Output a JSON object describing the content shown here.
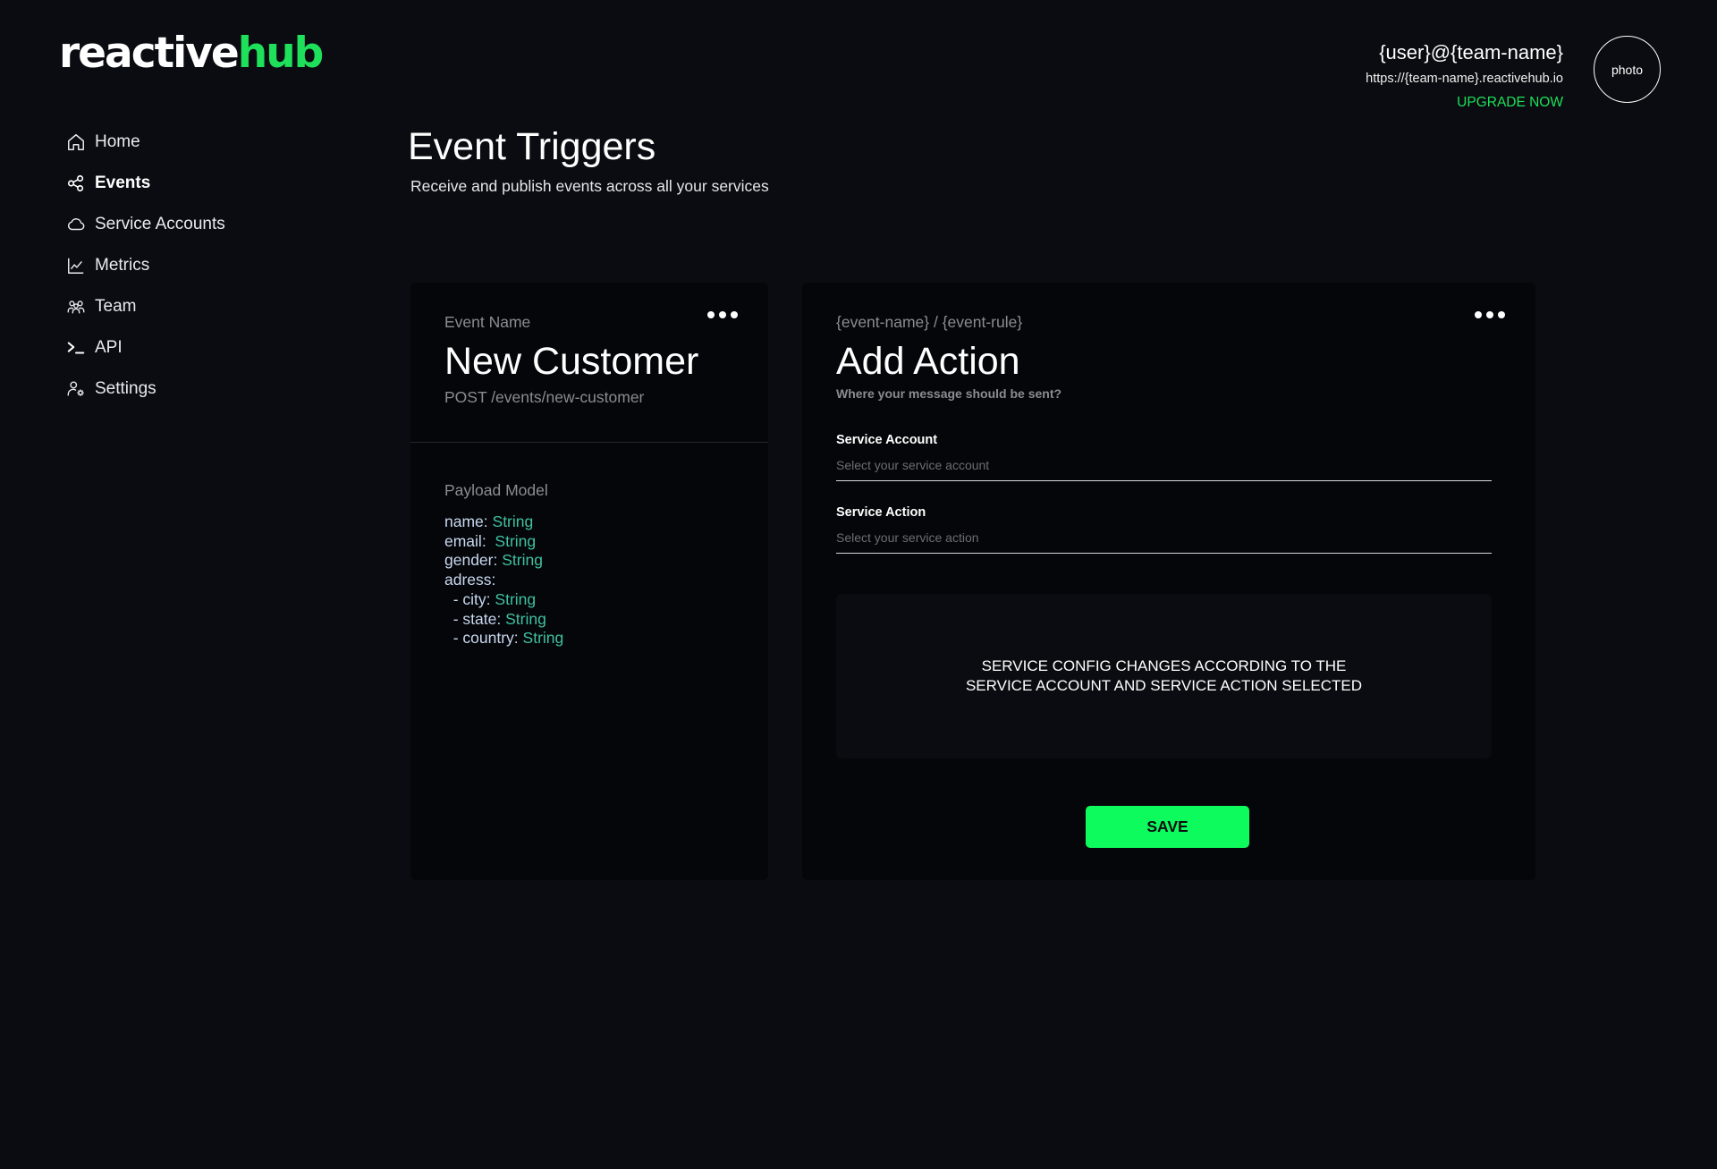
{
  "brand": {
    "logo_part1": "reactive",
    "logo_part2": "hub",
    "accent_color": "#1ee05a",
    "button_color": "#0efb5d"
  },
  "sidebar": {
    "items": [
      {
        "label": "Home",
        "icon": "home-icon",
        "active": false
      },
      {
        "label": "Events",
        "icon": "share-icon",
        "active": true
      },
      {
        "label": "Service Accounts",
        "icon": "cloud-icon",
        "active": false
      },
      {
        "label": "Metrics",
        "icon": "chart-icon",
        "active": false
      },
      {
        "label": "Team",
        "icon": "team-icon",
        "active": false
      },
      {
        "label": "API",
        "icon": "terminal-icon",
        "active": false
      },
      {
        "label": "Settings",
        "icon": "user-gear-icon",
        "active": false
      }
    ]
  },
  "header": {
    "user": "{user}@{team-name}",
    "url": "https://{team-name}.reactivehub.io",
    "upgrade_label": "UPGRADE NOW",
    "avatar_label": "photo"
  },
  "page": {
    "title": "Event Triggers",
    "subtitle": "Receive and publish events across all your services"
  },
  "event_card": {
    "label": "Event Name",
    "title": "New Customer",
    "endpoint": "POST /events/new-customer",
    "payload_label": "Payload Model",
    "payload": [
      {
        "key": "name:",
        "type": "String"
      },
      {
        "key": "email: ",
        "type": "String"
      },
      {
        "key": "gender:",
        "type": "String"
      },
      {
        "key": "adress:",
        "type": ""
      },
      {
        "key": "  - city:",
        "type": "String"
      },
      {
        "key": "  - state:",
        "type": "String"
      },
      {
        "key": "  - country:",
        "type": "String"
      }
    ]
  },
  "action_card": {
    "path": "{event-name} / {event-rule}",
    "title": "Add Action",
    "hint": "Where your message should be sent?",
    "service_account_label": "Service Account",
    "service_account_placeholder": "Select your service account",
    "service_action_label": "Service Action",
    "service_action_placeholder": "Select your service action",
    "config_text": "SERVICE CONFIG CHANGES ACCORDING TO THE SERVICE ACCOUNT AND SERVICE ACTION SELECTED",
    "save_label": "SAVE"
  }
}
